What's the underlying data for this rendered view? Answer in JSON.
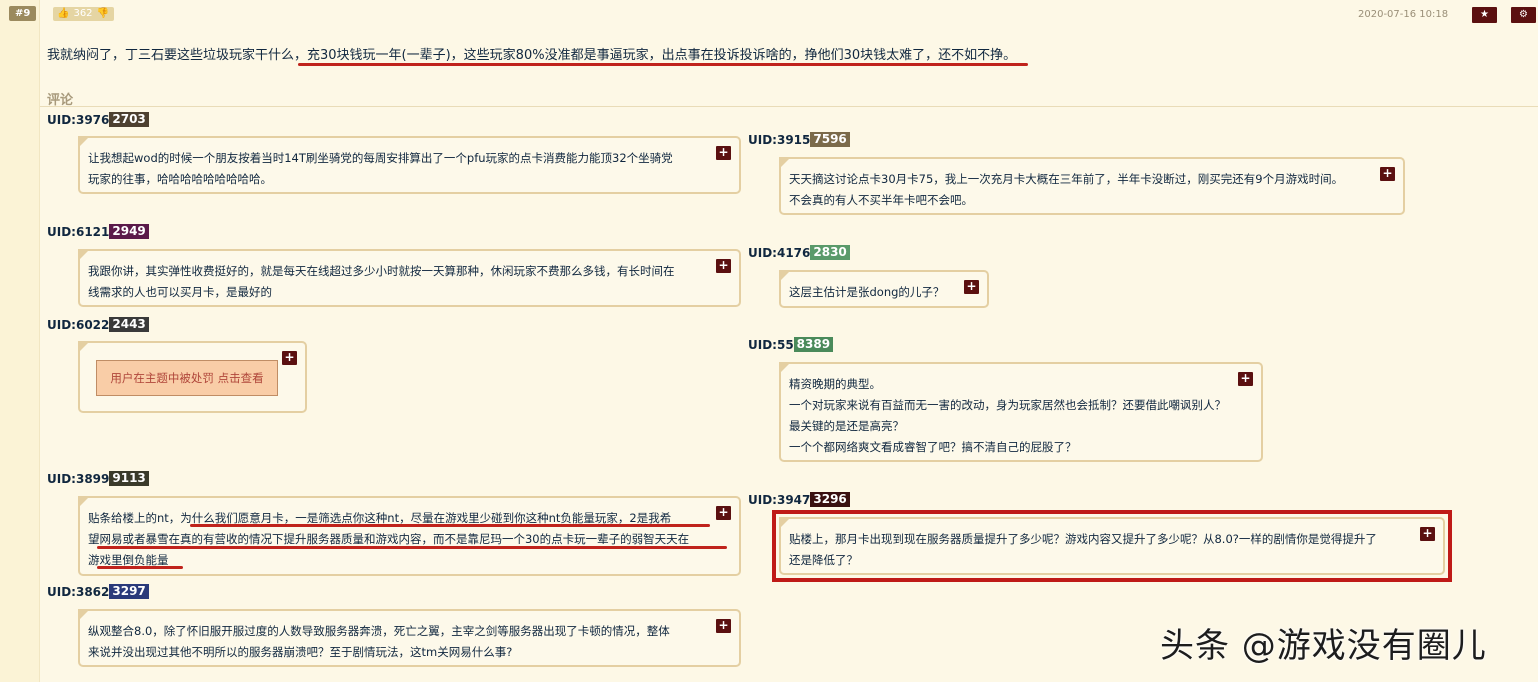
{
  "post": {
    "floor": "#9",
    "likes": "362",
    "date": "2020-07-16 10:18",
    "star_icon": "★",
    "gear_icon": "⚙",
    "text": "我就纳闷了，丁三石要这些垃圾玩家干什么，充30块钱玩一年(一辈子)，这些玩家80%没准都是事逼玩家，出点事在投诉投诉啥的，挣他们30块钱太难了，还不如不挣。"
  },
  "comments_section_title": "评论",
  "plus_label": "+",
  "comments": [
    {
      "uid_label": "UID:3976",
      "badge": "2703",
      "badge_color": "#4d4030",
      "lines": [
        "让我想起wod的时候一个朋友按着当时14T刷坐骑党的每周安排算出了一个pfu玩家的点卡消费能力能顶32个坐骑党",
        "玩家的往事，哈哈哈哈哈哈哈哈哈。"
      ]
    },
    {
      "uid_label": "UID:3915",
      "badge": "7596",
      "badge_color": "#7b6a4a",
      "lines": [
        "天天摘这讨论点卡30月卡75，我上一次充月卡大概在三年前了，半年卡没断过，刚买完还有9个月游戏时间。",
        "不会真的有人不买半年卡吧不会吧。"
      ]
    },
    {
      "uid_label": "UID:6121",
      "badge": "2949",
      "badge_color": "#5b1a4a",
      "lines": [
        "我跟你讲，其实弹性收费挺好的，就是每天在线超过多少小时就按一天算那种，休闲玩家不费那么多钱，有长时间在",
        "线需求的人也可以买月卡，是最好的"
      ]
    },
    {
      "uid_label": "UID:4176",
      "badge": "2830",
      "badge_color": "#5a9a6a",
      "lines": [
        "这层主估计是张dong的儿子？"
      ]
    },
    {
      "uid_label": "UID:6022",
      "badge": "2443",
      "badge_color": "#3a3a3a",
      "punished_text": "用户在主题中被处罚 点击查看"
    },
    {
      "uid_label": "UID:55",
      "badge": "8389",
      "badge_color": "#4a8a5a",
      "lines": [
        "精资晚期的典型。",
        "一个对玩家来说有百益而无一害的改动，身为玩家居然也会抵制？还要借此嘲讽别人？",
        "最关键的是还是高亮？",
        "一个个都网络爽文看成睿智了吧？搞不清自己的屁股了？"
      ]
    },
    {
      "uid_label": "UID:3899",
      "badge": "9113",
      "badge_color": "#3a3a2a",
      "lines": [
        "贴条给楼上的nt，为什么我们愿意月卡，一是筛选点你这种nt，尽量在游戏里少碰到你这种nt负能量玩家，2是我希",
        "望网易或者暴雪在真的有营收的情况下提升服务器质量和游戏内容，而不是靠尼玛一个30的点卡玩一辈子的弱智天天在",
        "游戏里倒负能量"
      ]
    },
    {
      "uid_label": "UID:3947",
      "badge": "3296",
      "badge_color": "#3a1010",
      "lines": [
        "贴楼上，那月卡出现到现在服务器质量提升了多少呢？游戏内容又提升了多少呢？从8.0?一样的剧情你是觉得提升了",
        "还是降低了？"
      ]
    },
    {
      "uid_label": "UID:3862",
      "badge": "3297",
      "badge_color": "#2a3a7a",
      "lines": [
        "纵观整合8.0，除了怀旧服开服过度的人数导致服务器奔溃，死亡之翼，主宰之剑等服务器出现了卡顿的情况，整体",
        "来说并没出现过其他不明所以的服务器崩溃吧？至于剧情玩法，这tm关网易什么事?"
      ]
    }
  ],
  "watermark": "头条 @游戏没有圈儿",
  "colors": {
    "accent_red": "#c0231c",
    "plus_bg": "#5b1010",
    "box_border": "#e4cfa2"
  }
}
